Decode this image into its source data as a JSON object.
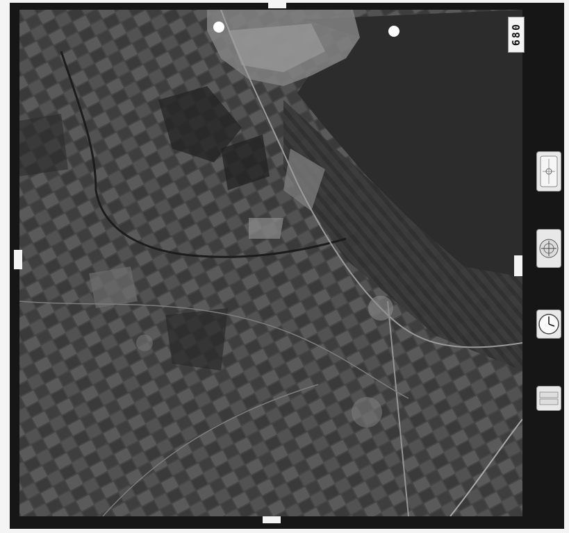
{
  "photo": {
    "frame_number": "680",
    "type": "aerial photograph",
    "colors": {
      "water": "#2c2c2c",
      "land": "#4a4a4a",
      "town": "#8a8a8a",
      "film_border": "#161616"
    }
  },
  "instruments": {
    "level": "level-bubble-icon",
    "altimeter": "altimeter-icon",
    "clock": "clock-icon",
    "counter": "counter-icon"
  }
}
